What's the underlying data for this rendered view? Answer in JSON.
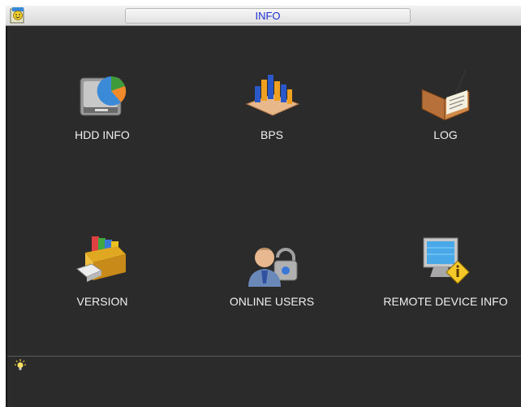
{
  "window": {
    "title": "INFO"
  },
  "icons": {
    "app": "app-smiley-icon",
    "hint": "lightbulb-icon"
  },
  "menu": {
    "items": [
      {
        "label": "HDD INFO",
        "icon": "hdd-info-icon"
      },
      {
        "label": "BPS",
        "icon": "bps-chart-icon"
      },
      {
        "label": "LOG",
        "icon": "log-book-icon"
      },
      {
        "label": "VERSION",
        "icon": "version-box-icon"
      },
      {
        "label": "ONLINE USERS",
        "icon": "online-users-icon"
      },
      {
        "label": "REMOTE DEVICE INFO",
        "icon": "remote-device-icon"
      }
    ]
  }
}
